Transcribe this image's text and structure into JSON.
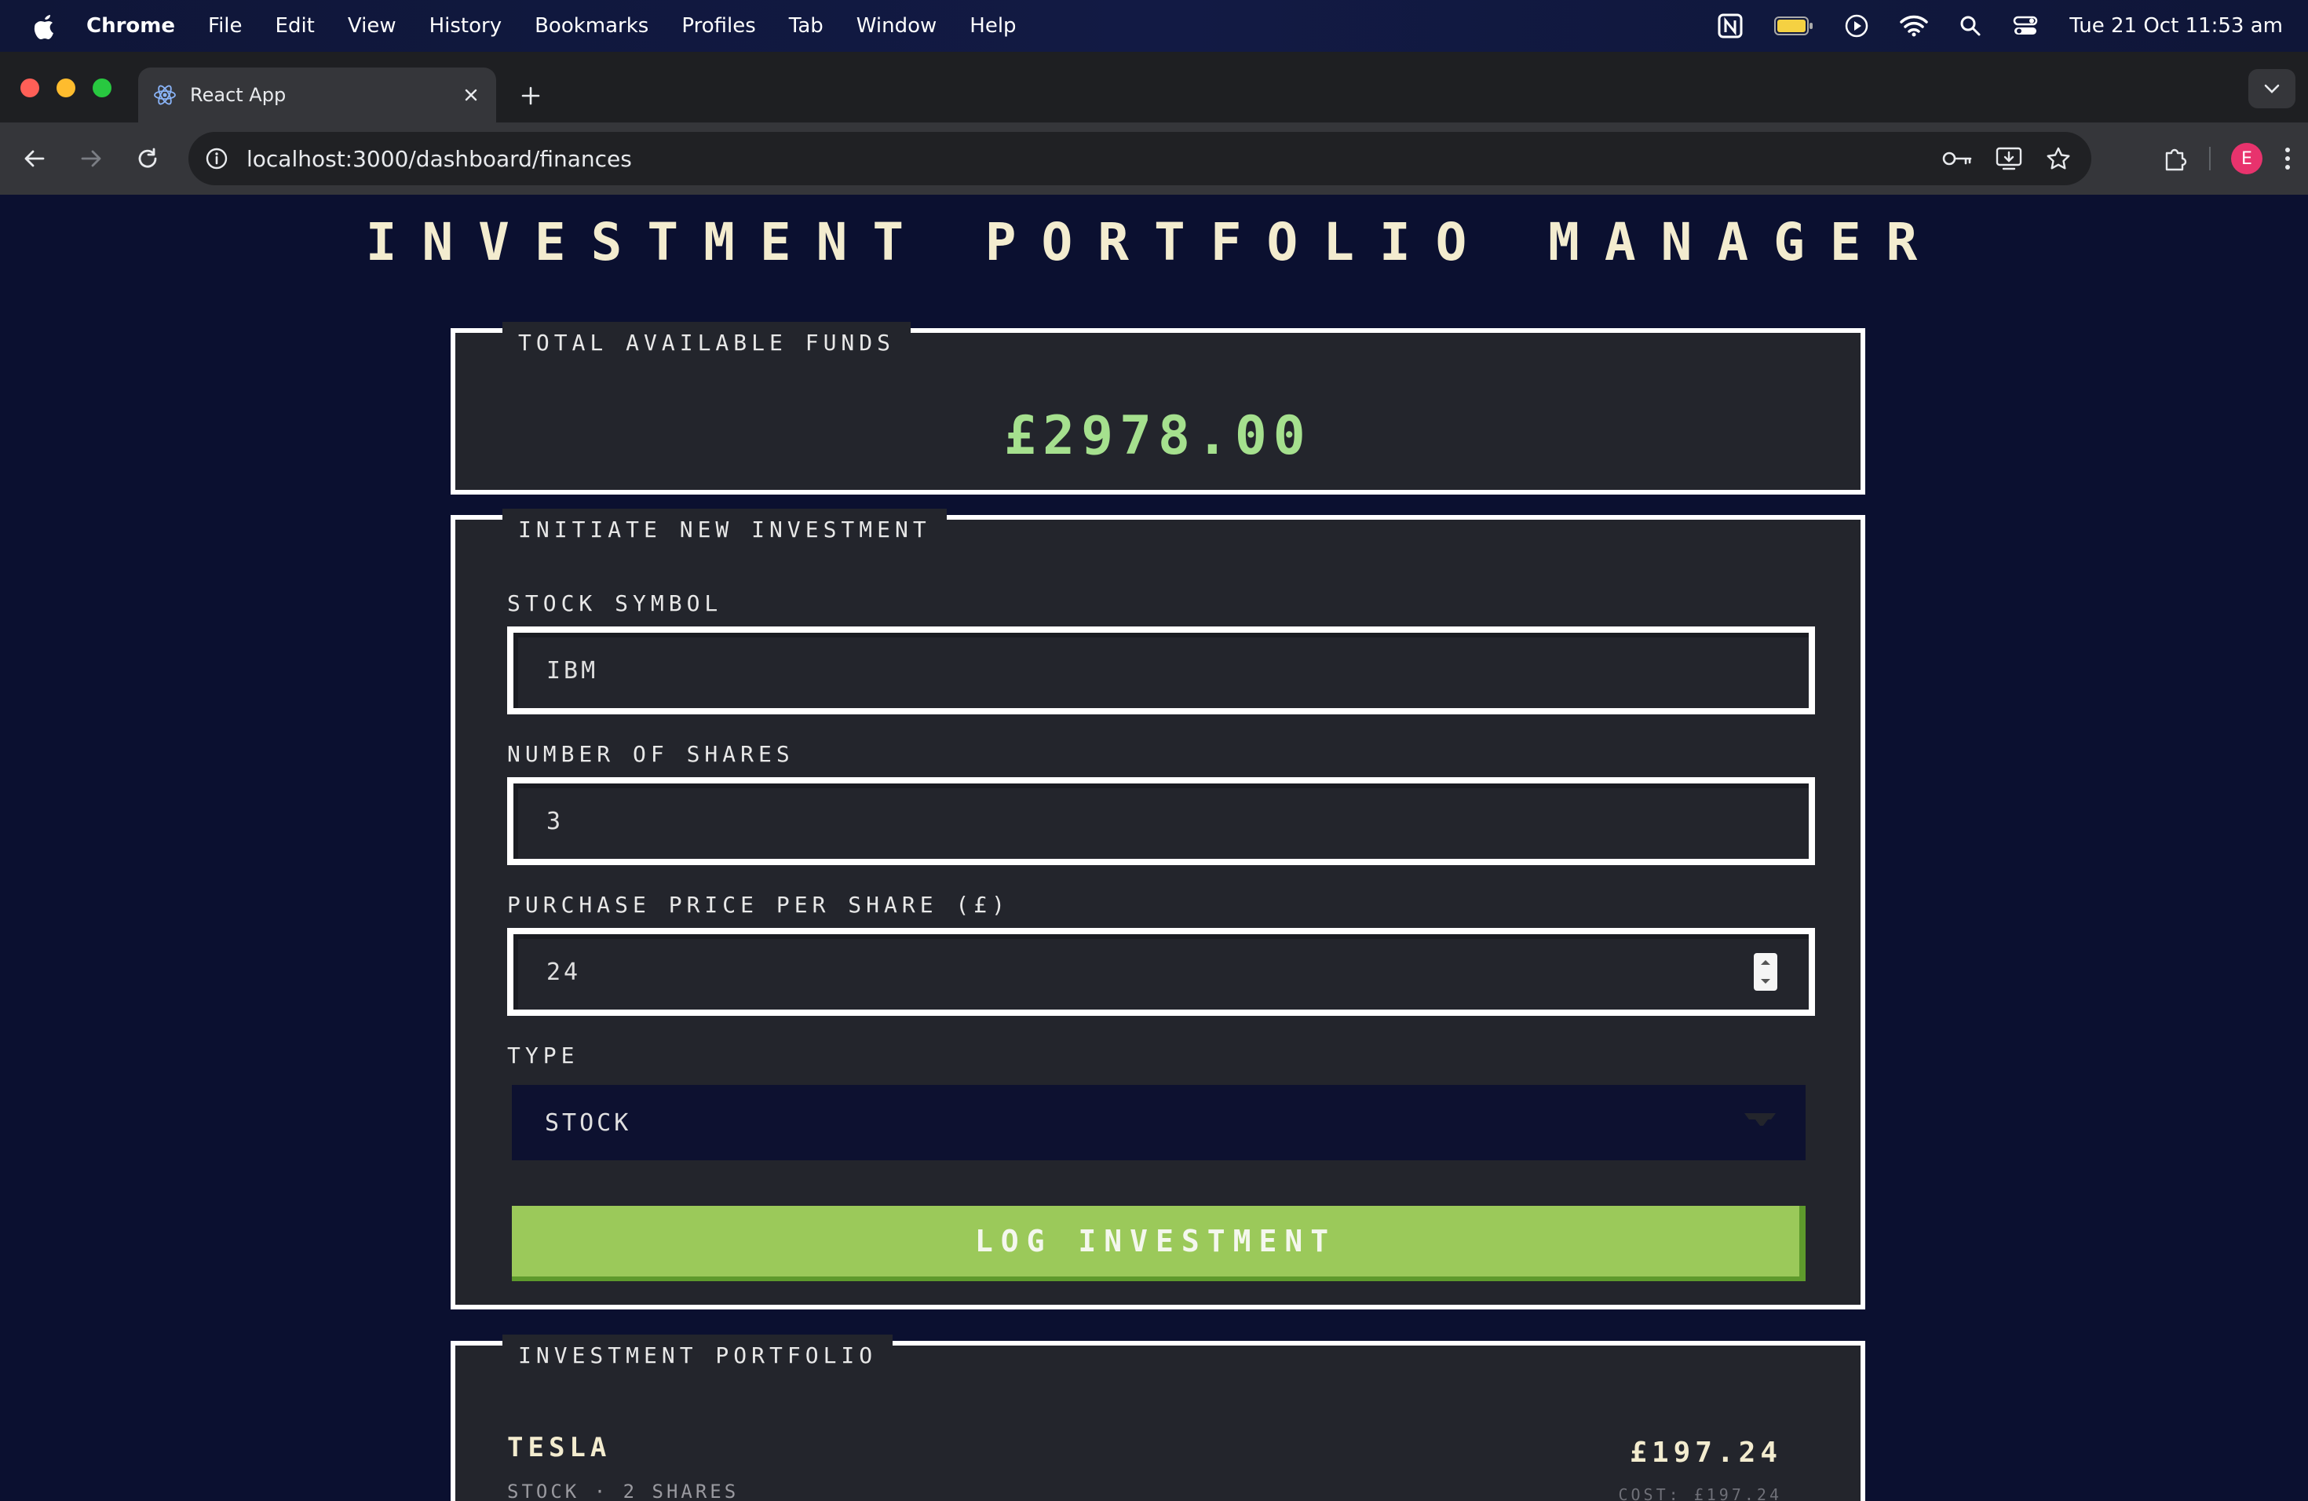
{
  "menubar": {
    "app_name": "Chrome",
    "items": [
      "File",
      "Edit",
      "View",
      "History",
      "Bookmarks",
      "Profiles",
      "Tab",
      "Window",
      "Help"
    ],
    "clock": "Tue 21 Oct  11:53 am"
  },
  "browser": {
    "tab_title": "React App",
    "url": "localhost:3000/dashboard/finances",
    "profile_initial": "E"
  },
  "app": {
    "title": "Investment Portfolio Manager",
    "funds": {
      "legend": "Total Available Funds",
      "amount": "£2978.00"
    },
    "form": {
      "legend": "Initiate New Investment",
      "symbol_label": "Stock Symbol",
      "symbol_value": "IBM",
      "shares_label": "Number of Shares",
      "shares_value": "3",
      "price_label": "Purchase Price Per Share (£)",
      "price_value": "24",
      "type_label": "Type",
      "type_value": "Stock",
      "submit_label": "Log Investment"
    },
    "portfolio": {
      "legend": "Investment Portfolio",
      "holdings": [
        {
          "name": "Tesla",
          "meta": "Stock · 2 Shares",
          "value": "£197.24",
          "cost": "Cost: £197.24"
        }
      ]
    }
  },
  "colors": {
    "page_bg": "#0b1030",
    "panel_bg": "#23252c",
    "accent_green": "#9bc95a",
    "funds_green": "#a5e08e",
    "title_cream": "#f3eccf"
  }
}
